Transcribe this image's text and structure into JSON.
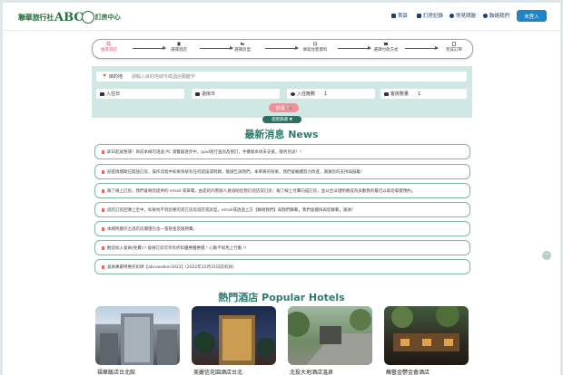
{
  "header": {
    "logo": {
      "part1": "聯華旅行社",
      "part2": "ABC",
      "part3": "訂房中心"
    },
    "nav": [
      {
        "label": "首頁",
        "icon": "home-icon"
      },
      {
        "label": "訂房記錄",
        "icon": "list-icon"
      },
      {
        "label": "常見問題",
        "icon": "question-icon"
      },
      {
        "label": "聯絡我們",
        "icon": "info-icon"
      }
    ],
    "login_label": "未登入"
  },
  "steps": [
    {
      "label": "搜尋酒店",
      "active": true
    },
    {
      "label": "選擇酒店",
      "active": false
    },
    {
      "label": "選擇房型",
      "active": false
    },
    {
      "label": "填寫住客資料",
      "active": false
    },
    {
      "label": "選擇付款方式",
      "active": false
    },
    {
      "label": "完成訂單",
      "active": false
    }
  ],
  "search": {
    "destination_label": "目的地",
    "destination_placeholder": "請輸入目的地城市或酒店關鍵字",
    "checkin_label": "入住日",
    "checkout_label": "退房日",
    "nights_label": "入住晚數",
    "nights_value": "1",
    "rooms_label": "客房數量",
    "rooms_value": "1",
    "search_button": "搜尋",
    "advanced_button": "進階篩選"
  },
  "news": {
    "title": "最新消息 News",
    "items": [
      "即日起試營運！目前本線可透過 PC 瀏覽器逐步中，ipad進行查詢及預訂，手機版本尚未支援，敬祈見諒！！",
      "就疫情期間已開放訂房，操作流程中如果系統有任何錯誤或問題，敬請告訴我們，本單將的效果，我們會繼續努力改進，謝謝您的支持與鼓勵！",
      "報了線上訂房，我們會將您提供的 email 或來電，由是的的客服人員協助您預訂酒店成訂房；報了線上付費向成訂房，並以合法證明將成為多數我的最可以取您掌握預約。",
      "酒店訂房回傳上至中，如果找不到您要的其它房房酒店或房型，email或透過上方【聯絡我們】與我們聯繫，我們會儘快與您聯繫，謝謝！",
      "本網所顯示之酒店房價僅包含一張稅金及服務費。",
      "歡迎加入會員(免費)!! 會員訂房可享有折扣優惠優惠價 ! 心動不如馬上行動 !!",
      "會員專屬特惠折扣碼【abcswalker2022】(2022年12月31日前有效)"
    ]
  },
  "hotels": {
    "title": "熱門酒店 Popular Hotels",
    "items": [
      {
        "name": "福華飯店台北館",
        "icon": "hotel-photo-icon"
      },
      {
        "name": "美麗信花園酒店台北",
        "icon": "hotel-photo-icon"
      },
      {
        "name": "北投大地酒店溫泉",
        "icon": "hotel-photo-icon"
      },
      {
        "name": "馥藝金鬱金香酒店",
        "icon": "hotel-photo-icon"
      }
    ]
  },
  "colors": {
    "brand": "#2a6e3e",
    "accent": "#1e83c7",
    "section_title": "#2e7a6f",
    "search_bg": "#cfe8e4"
  }
}
